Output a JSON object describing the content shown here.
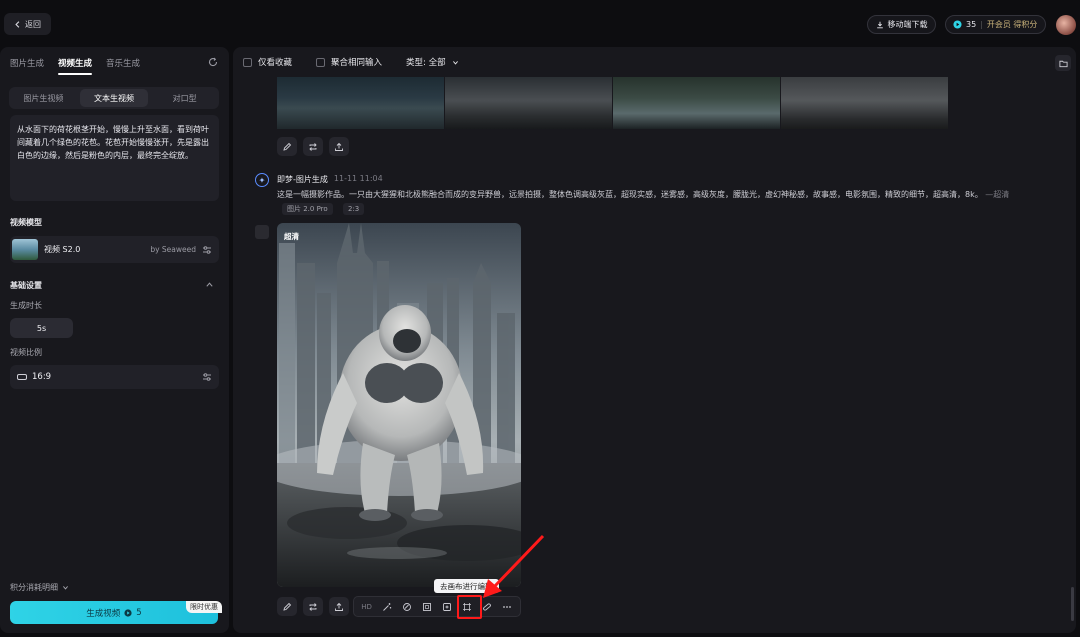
{
  "topbar": {
    "back_label": "返回",
    "mobile_download_label": "移动端下载",
    "credits": "35",
    "vip_label": "开会员 得积分"
  },
  "sidebar": {
    "tabs": [
      {
        "label": "图片生成",
        "active": false
      },
      {
        "label": "视频生成",
        "active": true
      },
      {
        "label": "音乐生成",
        "active": false
      }
    ],
    "subtabs": [
      {
        "label": "图片生视频",
        "active": false
      },
      {
        "label": "文本生视频",
        "active": true
      },
      {
        "label": "对口型",
        "active": false
      }
    ],
    "prompt_text": "从水面下的荷花根茎开始，慢慢上升至水面，看到荷叶间藏着几个绿色的花苞。花苞开始慢慢张开，先是露出白色的边缘，然后是粉色的内层，最终完全绽放。",
    "video_model_label": "视频模型",
    "model_name": "视频 S2.0",
    "model_by": "by Seaweed",
    "basic_settings_label": "基础设置",
    "duration_label": "生成时长",
    "duration_value": "5s",
    "ratio_label": "视频比例",
    "ratio_value": "16:9",
    "points_detail_label": "积分消耗明细",
    "generate_label": "生成视频",
    "generate_cost": "5",
    "promo_label": "限时优惠"
  },
  "main": {
    "filters": {
      "favorites_label": "仅看收藏",
      "aggregate_label": "聚合相同输入",
      "type_label": "类型: 全部"
    },
    "message": {
      "bot_name": "即梦-图片生成",
      "time": "11-11  11:04",
      "prompt": "这是一幅摄影作品。一只由大猩猩和北极熊融合而成的变异野兽，远景拍摄，整体色调高级灰蓝，超现实感，迷雾感，高级灰度，朦胧光，虚幻神秘感，故事感，电影氛围，精致的细节，超高清，8k。",
      "prompt_more": "—超清",
      "tags": [
        "图片 2.0 Pro",
        "2:3"
      ],
      "hd_badge": "超清",
      "toolbar_hd_label": "HD",
      "tooltip": "去画布进行编辑"
    }
  },
  "colors": {
    "accent_cyan": "#2fd3e6",
    "highlight_red": "#ff1a1a",
    "panel_bg": "#18181d",
    "page_bg": "#0d0d10"
  }
}
